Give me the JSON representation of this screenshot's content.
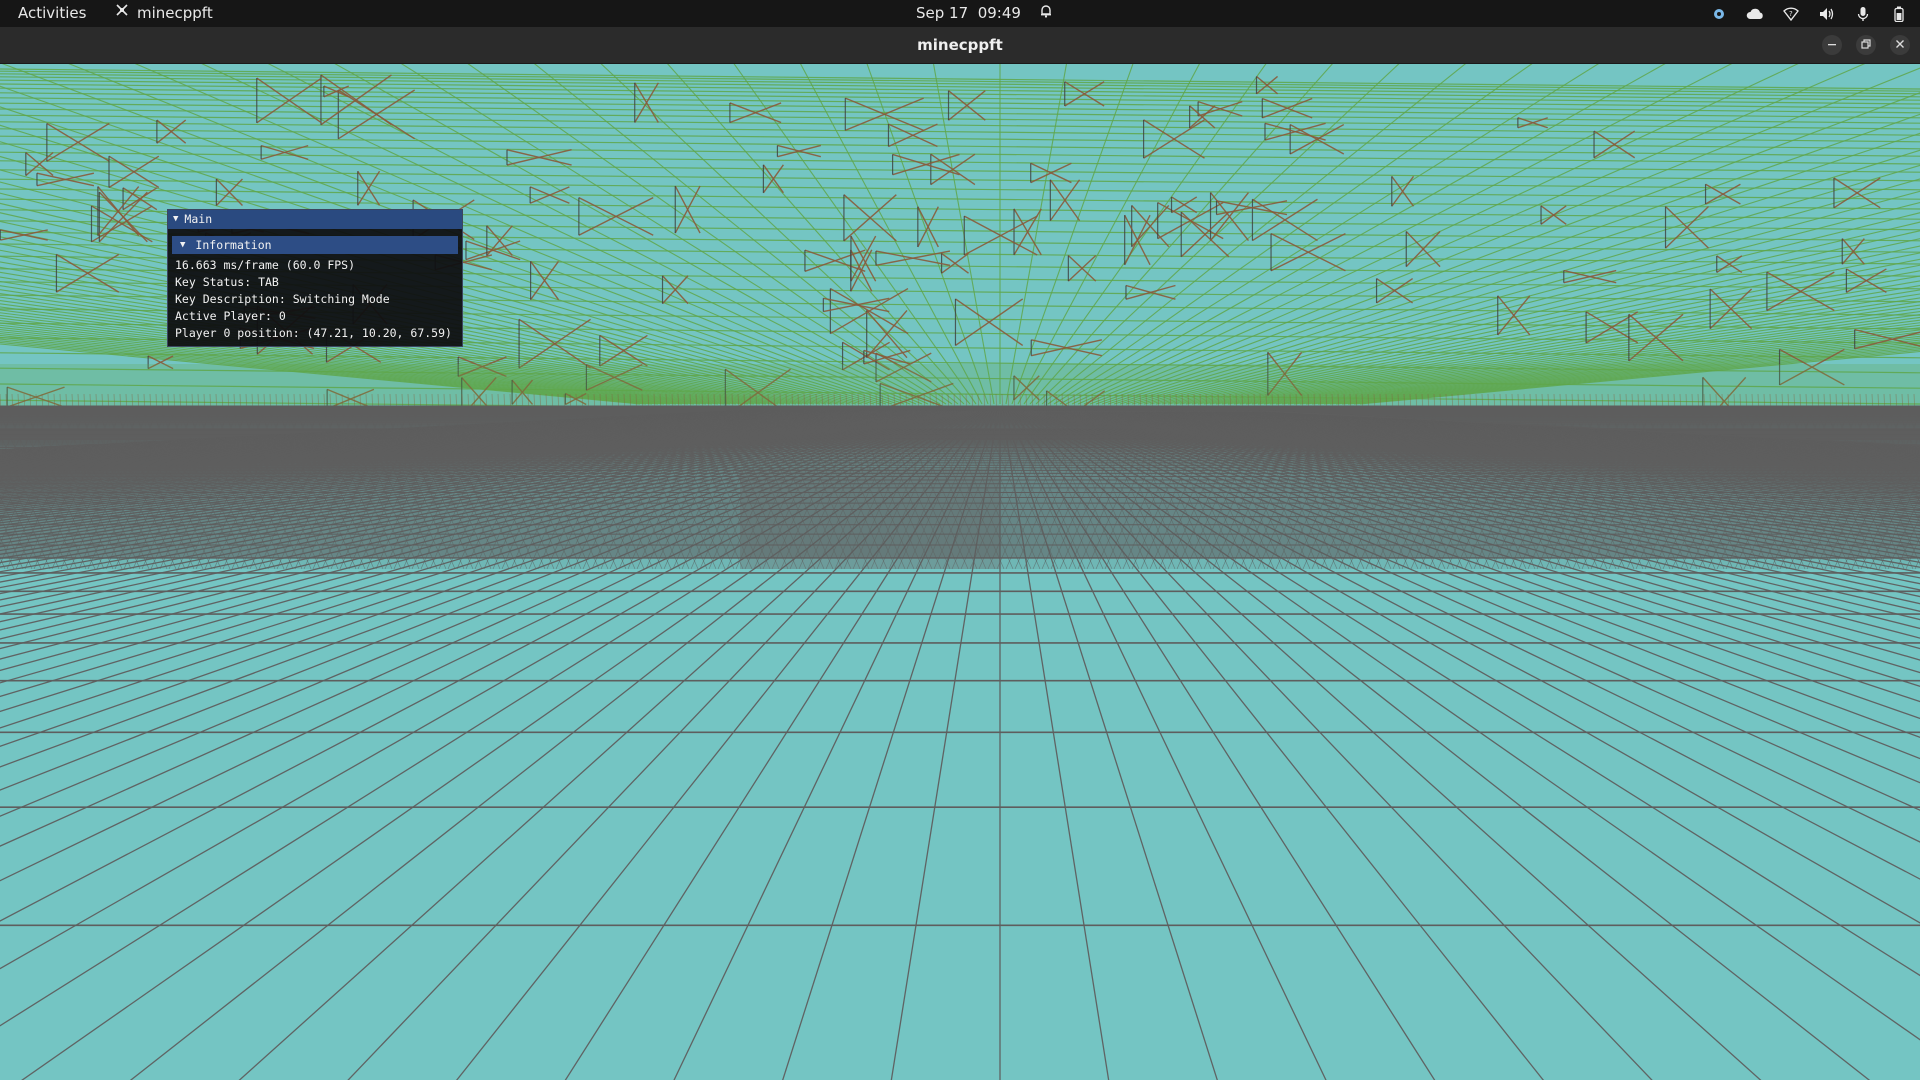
{
  "topbar": {
    "activities_label": "Activities",
    "app_name": "minecppft",
    "date": "Sep 17",
    "time": "09:49",
    "tray_icons": [
      "color-picker-icon",
      "cloud-icon",
      "wifi-icon",
      "volume-icon",
      "microphone-icon",
      "battery-icon"
    ]
  },
  "window": {
    "title": "minecppft",
    "buttons": [
      "minimize-icon",
      "restore-icon",
      "close-icon"
    ]
  },
  "scene": {
    "sky_color": "#74c5c3",
    "grid_color": "#5e5e5e",
    "foliage_color": "#5fa64a",
    "wood_color": "#8a5a3a"
  },
  "imgui": {
    "window_title": "Main",
    "section_title": "Information",
    "lines": [
      "16.663 ms/frame (60.0 FPS)",
      "Key Status: TAB",
      "Key Description: Switching Mode",
      "Active Player: 0",
      "Player 0 position: (47.21, 10.20, 67.59)"
    ]
  }
}
